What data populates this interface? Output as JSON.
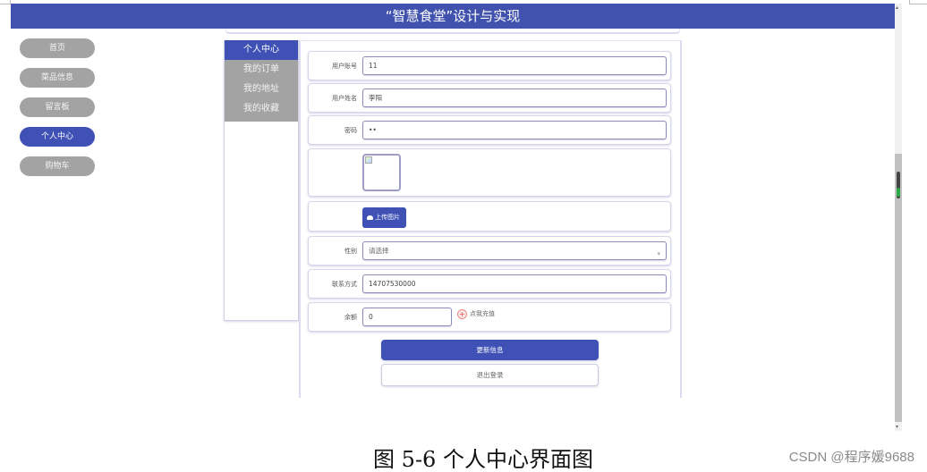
{
  "header": {
    "title": "“智慧食堂”设计与实现"
  },
  "colors": {
    "brand": "#3f51b5",
    "nav_inactive": "#a3a3a3",
    "recharge_accent": "#e04848"
  },
  "sidebar": {
    "items": [
      {
        "label": "首页",
        "active": false
      },
      {
        "label": "菜品信息",
        "active": false
      },
      {
        "label": "留言板",
        "active": false
      },
      {
        "label": "个人中心",
        "active": true
      },
      {
        "label": "购物车",
        "active": false
      }
    ]
  },
  "subnav": {
    "items": [
      {
        "label": "个人中心",
        "active": true
      },
      {
        "label": "我的订单",
        "active": false
      },
      {
        "label": "我的地址",
        "active": false
      },
      {
        "label": "我的收藏",
        "active": false
      }
    ]
  },
  "form": {
    "account": {
      "label": "用户账号",
      "value": "11"
    },
    "name": {
      "label": "用户姓名",
      "value": "李阳"
    },
    "password": {
      "label": "密码",
      "value": "••"
    },
    "upload": {
      "label": "上传图片",
      "icon": "cloud-upload-icon"
    },
    "gender": {
      "label": "性别",
      "placeholder": "请选择",
      "icon": "chevron-down-icon"
    },
    "phone": {
      "label": "联系方式",
      "value": "14707530000"
    },
    "balance": {
      "label": "余额",
      "value": "0",
      "recharge_label": "点我充值",
      "recharge_icon": "plus-circle-icon"
    }
  },
  "actions": {
    "update_label": "更新信息",
    "logout_label": "退出登录"
  },
  "caption": "图 5-6 个人中心界面图",
  "watermark": "CSDN @程序媛9688"
}
